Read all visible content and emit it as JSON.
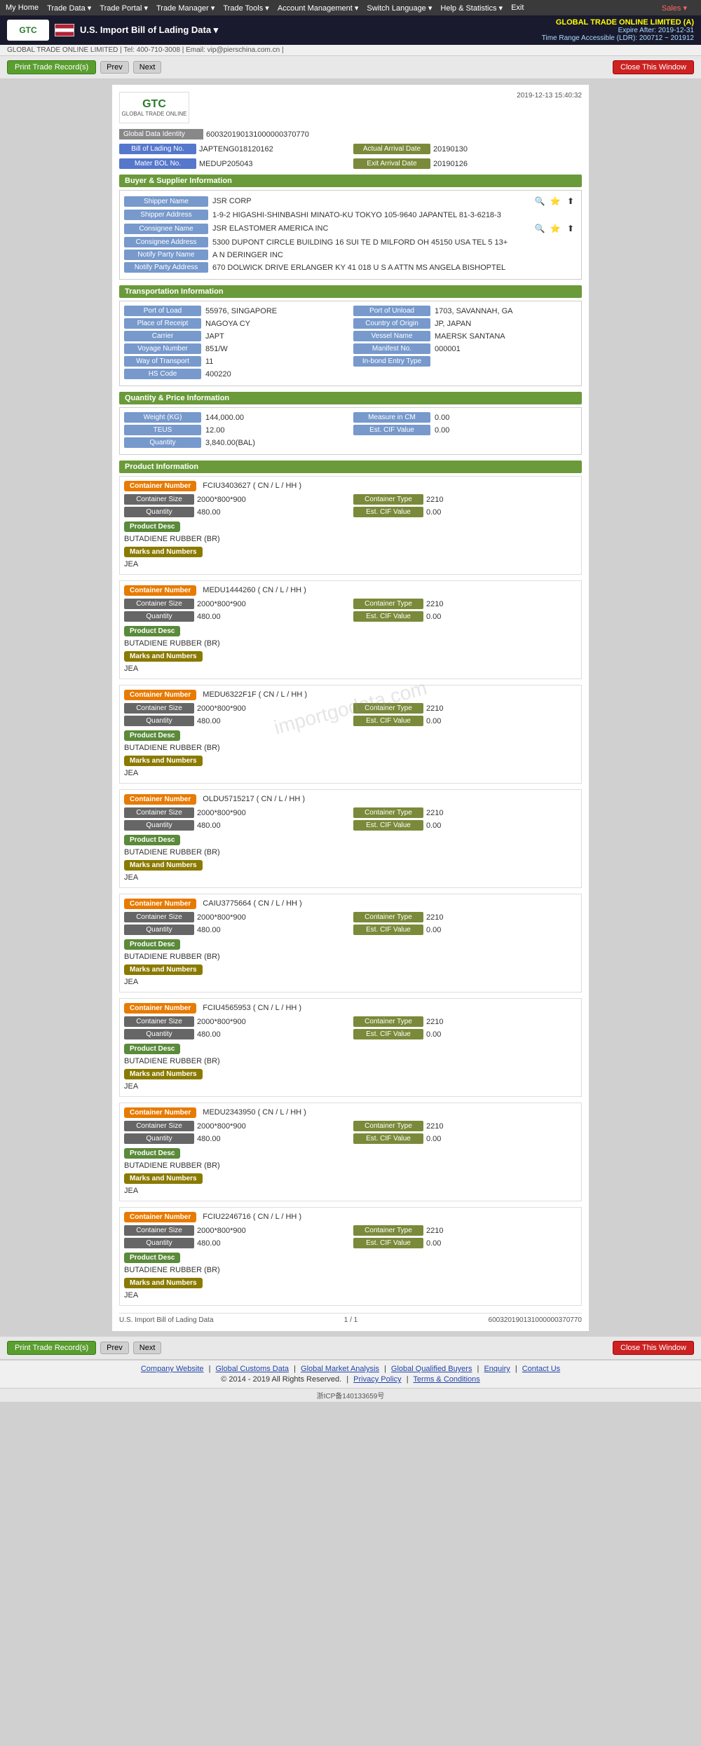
{
  "nav": {
    "items": [
      "My Home",
      "Trade Data",
      "Trade Portal",
      "Trade Manager",
      "Trade Tools",
      "Account Management",
      "Switch Language",
      "Help & Statistics",
      "Exit"
    ],
    "sales": "Sales"
  },
  "company": {
    "logo": "GTC",
    "flag": "US",
    "page_title": "U.S. Import Bill of Lading Data",
    "dropdown_arrow": "▼",
    "company_name": "GLOBAL TRADE ONLINE LIMITED (A)",
    "expire": "Expire After: 2019-12-31",
    "time_range": "Time Range Accessible (LDR): 200712 ~ 201912"
  },
  "sub_header": {
    "text": "GLOBAL TRADE ONLINE LIMITED | Tel: 400-710-3008 | Email: vip@pierschina.com.cn |"
  },
  "toolbar": {
    "print_btn": "Print Trade Record(s)",
    "prev_btn": "Prev",
    "next_btn": "Next",
    "close_btn": "Close This Window"
  },
  "timestamp": "2019-12-13 15:40:32",
  "global_data": {
    "label": "Global Data Identity",
    "value": "600320190131000000370770"
  },
  "bol": {
    "bill_label": "Bill of Lading No.",
    "bill_value": "JAPTENG018120162",
    "actual_label": "Actual Arrival Date",
    "actual_value": "20190130",
    "mater_label": "Mater BOL No.",
    "mater_value": "MEDUP205043",
    "exit_label": "Exit Arrival Date",
    "exit_value": "20190126"
  },
  "buyer_supplier": {
    "header": "Buyer & Supplier Information",
    "shipper_name_label": "Shipper Name",
    "shipper_name_value": "JSR CORP",
    "shipper_addr_label": "Shipper Address",
    "shipper_addr_value": "1-9-2 HIGASHI-SHINBASHI MINATO-KU TOKYO 105-9640 JAPANTEL 81-3-6218-3",
    "consignee_label": "Consignee Name",
    "consignee_value": "JSR ELASTOMER AMERICA INC",
    "consignee_addr_label": "Consignee Address",
    "consignee_addr_value": "5300 DUPONT CIRCLE BUILDING 16 SUI TE D MILFORD OH 45150 USA TEL 5 13+",
    "notify_label": "Notify Party Name",
    "notify_value": "A N DERINGER INC",
    "notify_addr_label": "Notify Party Address",
    "notify_addr_value": "670 DOLWICK DRIVE ERLANGER KY 41 018 U S A ATTN MS ANGELA BISHOPTEL"
  },
  "transport": {
    "header": "Transportation Information",
    "port_load_label": "Port of Load",
    "port_load_value": "55976, SINGAPORE",
    "port_unload_label": "Port of Unload",
    "port_unload_value": "1703, SAVANNAH, GA",
    "place_receipt_label": "Place of Receipt",
    "place_receipt_value": "NAGOYA CY",
    "country_origin_label": "Country of Origin",
    "country_origin_value": "JP, JAPAN",
    "carrier_label": "Carrier",
    "carrier_value": "JAPT",
    "vessel_label": "Vessel Name",
    "vessel_value": "MAERSK SANTANA",
    "voyage_label": "Voyage Number",
    "voyage_value": "851/W",
    "manifest_label": "Manifest No.",
    "manifest_value": "000001",
    "way_label": "Way of Transport",
    "way_value": "11",
    "inbond_label": "In-bond Entry Type",
    "inbond_value": "",
    "hs_label": "HS Code",
    "hs_value": "400220"
  },
  "quantity_price": {
    "header": "Quantity & Price Information",
    "weight_label": "Weight (KG)",
    "weight_value": "144,000.00",
    "measure_label": "Measure in CM",
    "measure_value": "0.00",
    "teus_label": "TEUS",
    "teus_value": "12.00",
    "est_cif_label": "Est. CIF Value",
    "est_cif_value": "0.00",
    "quantity_label": "Quantity",
    "quantity_value": "3,840.00(BAL)"
  },
  "product_info": {
    "header": "Product Information",
    "containers": [
      {
        "number": "FCIU3403627 ( CN / L / HH )",
        "size_label": "Container Size",
        "size_value": "2000*800*900",
        "type_label": "Container Type",
        "type_value": "2210",
        "qty_label": "Quantity",
        "qty_value": "480.00",
        "cif_label": "Est. CIF Value",
        "cif_value": "0.00",
        "product_desc": "BUTADIENE RUBBER (BR)",
        "marks": "JEA"
      },
      {
        "number": "MEDU1444260 ( CN / L / HH )",
        "size_label": "Container Size",
        "size_value": "2000*800*900",
        "type_label": "Container Type",
        "type_value": "2210",
        "qty_label": "Quantity",
        "qty_value": "480.00",
        "cif_label": "Est. CIF Value",
        "cif_value": "0.00",
        "product_desc": "BUTADIENE RUBBER (BR)",
        "marks": "JEA"
      },
      {
        "number": "MEDU6322F1F ( CN / L / HH )",
        "size_label": "Container Size",
        "size_value": "2000*800*900",
        "type_label": "Container Type",
        "type_value": "2210",
        "qty_label": "Quantity",
        "qty_value": "480.00",
        "cif_label": "Est. CIF Value",
        "cif_value": "0.00",
        "product_desc": "BUTADIENE RUBBER (BR)",
        "marks": "JEA"
      },
      {
        "number": "OLDU5715217 ( CN / L / HH )",
        "size_label": "Container Size",
        "size_value": "2000*800*900",
        "type_label": "Container Type",
        "type_value": "2210",
        "qty_label": "Quantity",
        "qty_value": "480.00",
        "cif_label": "Est. CIF Value",
        "cif_value": "0.00",
        "product_desc": "BUTADIENE RUBBER (BR)",
        "marks": "JEA"
      },
      {
        "number": "CAIU3775664 ( CN / L / HH )",
        "size_label": "Container Size",
        "size_value": "2000*800*900",
        "type_label": "Container Type",
        "type_value": "2210",
        "qty_label": "Quantity",
        "qty_value": "480.00",
        "cif_label": "Est. CIF Value",
        "cif_value": "0.00",
        "product_desc": "BUTADIENE RUBBER (BR)",
        "marks": "JEA"
      },
      {
        "number": "FCIU4565953 ( CN / L / HH )",
        "size_label": "Container Size",
        "size_value": "2000*800*900",
        "type_label": "Container Type",
        "type_value": "2210",
        "qty_label": "Quantity",
        "qty_value": "480.00",
        "cif_label": "Est. CIF Value",
        "cif_value": "0.00",
        "product_desc": "BUTADIENE RUBBER (BR)",
        "marks": "JEA"
      },
      {
        "number": "MEDU2343950 ( CN / L / HH )",
        "size_label": "Container Size",
        "size_value": "2000*800*900",
        "type_label": "Container Type",
        "type_value": "2210",
        "qty_label": "Quantity",
        "qty_value": "480.00",
        "cif_label": "Est. CIF Value",
        "cif_value": "0.00",
        "product_desc": "BUTADIENE RUBBER (BR)",
        "marks": "JEA"
      },
      {
        "number": "FCIU2246716 ( CN / L / HH )",
        "size_label": "Container Size",
        "size_value": "2000*800*900",
        "type_label": "Container Type",
        "type_value": "2210",
        "qty_label": "Quantity",
        "qty_value": "480.00",
        "cif_label": "Est. CIF Value",
        "cif_value": "0.00",
        "product_desc": "BUTADIENE RUBBER (BR)",
        "marks": "JEA"
      }
    ]
  },
  "page_footer": {
    "left": "U.S. Import Bill of Lading Data",
    "page_info": "1 / 1",
    "record_id": "600320190131000000370770"
  },
  "bottom_toolbar": {
    "print_btn": "Print Trade Record(s)",
    "prev_btn": "Prev",
    "next_btn": "Next",
    "close_btn": "Close This Window"
  },
  "footer_links": {
    "company": "Company Website",
    "global_customs": "Global Customs Data",
    "global_market": "Global Market Analysis",
    "global_buyers": "Global Qualified Buyers",
    "enquiry": "Enquiry",
    "contact": "Contact Us",
    "copyright": "© 2014 - 2019 All Rights Reserved.",
    "privacy": "Privacy Policy",
    "terms": "Terms & Conditions"
  },
  "icp": {
    "text": "浙ICP备140133659号"
  }
}
